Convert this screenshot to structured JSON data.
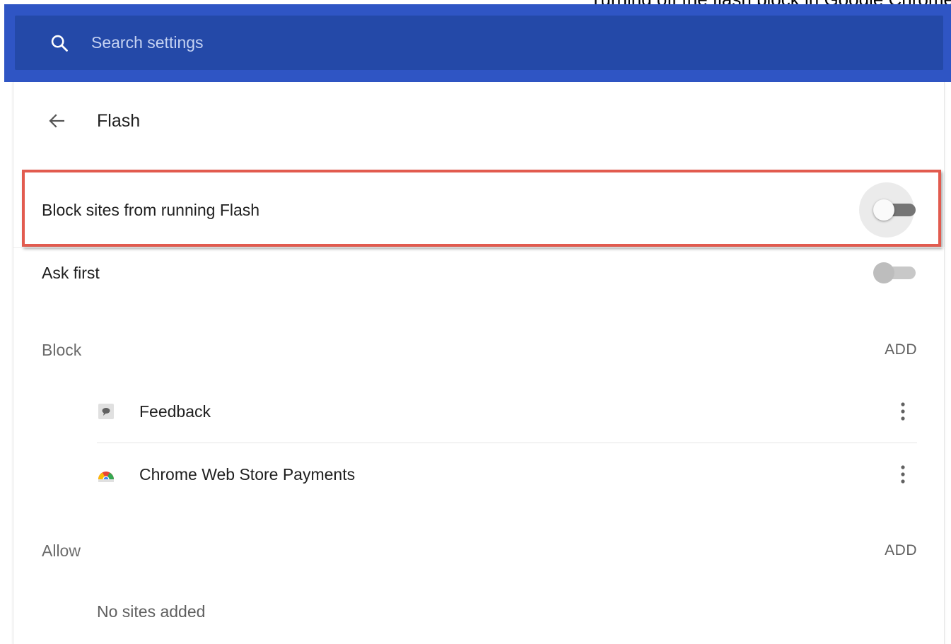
{
  "caption": {
    "text": "Turning off the flash block in Google Chrome"
  },
  "search": {
    "placeholder": "Search settings",
    "value": ""
  },
  "subpage": {
    "title": "Flash"
  },
  "settings": {
    "block_flash": {
      "label": "Block sites from running Flash",
      "enabled": false
    },
    "ask_first": {
      "label": "Ask first",
      "enabled": false
    }
  },
  "block_section": {
    "title": "Block",
    "add_label": "ADD",
    "sites": [
      {
        "name": "Feedback",
        "icon": "feedback-icon"
      },
      {
        "name": "Chrome Web Store Payments",
        "icon": "chrome-web-store-icon"
      }
    ]
  },
  "allow_section": {
    "title": "Allow",
    "add_label": "ADD",
    "empty_text": "No sites added"
  },
  "colors": {
    "header_band": "#2f55c4",
    "search_bar": "#2449a8",
    "highlight_border": "#e25b4f",
    "toggle_off_track": "#bdbdbd",
    "toggle_hover_track": "#757575"
  }
}
